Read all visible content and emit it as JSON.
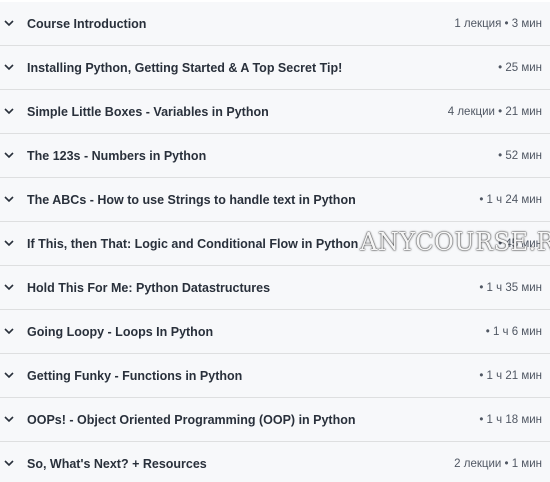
{
  "sections": [
    {
      "title": "Course Introduction",
      "meta": "1 лекция • 3 мин"
    },
    {
      "title": "Installing Python, Getting Started & A Top Secret Tip!",
      "meta": "• 25 мин"
    },
    {
      "title": "Simple Little Boxes - Variables in Python",
      "meta": "4 лекции • 21 мин"
    },
    {
      "title": "The 123s - Numbers in Python",
      "meta": "• 52 мин"
    },
    {
      "title": "The ABCs - How to use Strings to handle text in Python",
      "meta": "• 1 ч 24 мин"
    },
    {
      "title": "If This, then That: Logic and Conditional Flow in Python",
      "meta": "• 45 мин"
    },
    {
      "title": "Hold This For Me: Python Datastructures",
      "meta": "• 1 ч 35 мин"
    },
    {
      "title": "Going Loopy - Loops In Python",
      "meta": "• 1 ч 6 мин"
    },
    {
      "title": "Getting Funky - Functions in Python",
      "meta": "• 1 ч 21 мин"
    },
    {
      "title": "OOPs! - Object Oriented Programming (OOP) in Python",
      "meta": "• 1 ч 18 мин"
    },
    {
      "title": "So, What's Next? + Resources",
      "meta": "2 лекции • 1 мин"
    }
  ],
  "watermark": "ANYCOURSE.RU",
  "icons": {
    "expand": "chevron-down-icon"
  },
  "colors": {
    "row_bg": "#f7f8fa",
    "divider": "#dedfe0",
    "title": "#29303b",
    "meta": "#505763"
  }
}
